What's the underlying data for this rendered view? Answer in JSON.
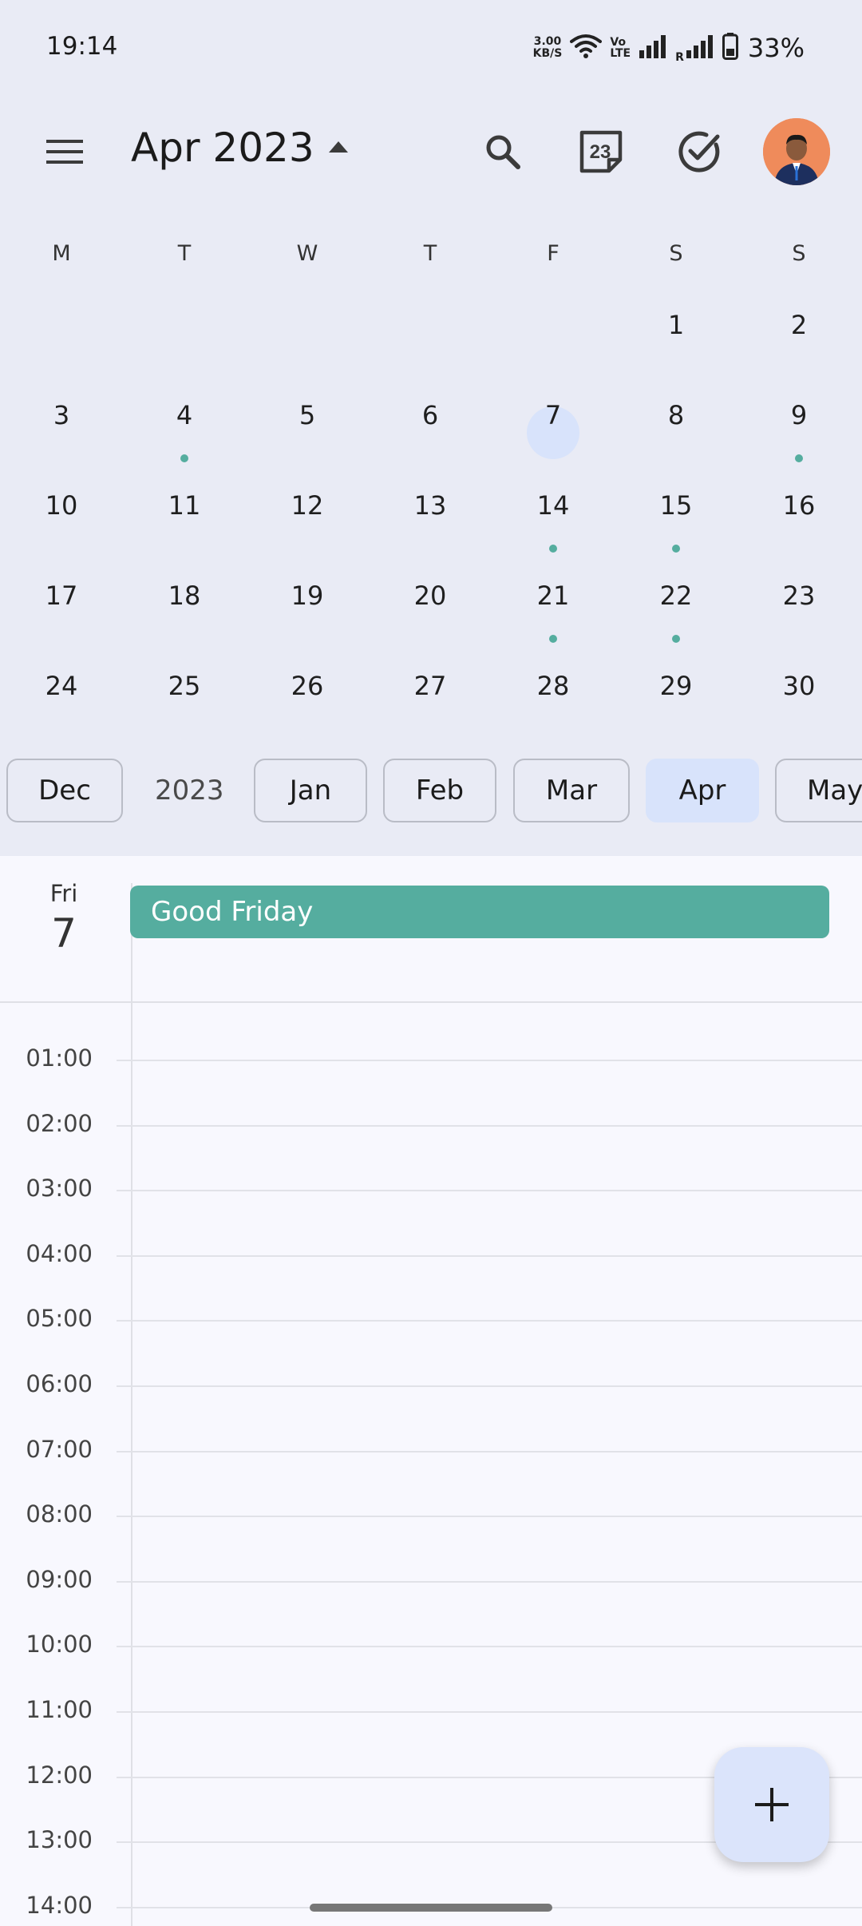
{
  "status_bar": {
    "time": "19:14",
    "net_speed_value": "3.00",
    "net_speed_unit": "KB/S",
    "volte_top": "Vo",
    "volte_bottom": "LTE",
    "roaming_label": "R",
    "battery": "33%"
  },
  "header": {
    "month_title": "Apr 2023",
    "today_date": "23",
    "icons": [
      "menu-icon",
      "caret-up-icon",
      "search-icon",
      "calendar-today-icon",
      "tasks-check-icon",
      "avatar"
    ]
  },
  "weekdays": [
    "M",
    "T",
    "W",
    "T",
    "F",
    "S",
    "S"
  ],
  "month_grid": {
    "weeks": [
      [
        {
          "d": ""
        },
        {
          "d": ""
        },
        {
          "d": ""
        },
        {
          "d": ""
        },
        {
          "d": ""
        },
        {
          "d": "1"
        },
        {
          "d": "2"
        }
      ],
      [
        {
          "d": "3"
        },
        {
          "d": "4",
          "dot": true
        },
        {
          "d": "5"
        },
        {
          "d": "6"
        },
        {
          "d": "7",
          "selected": true
        },
        {
          "d": "8"
        },
        {
          "d": "9",
          "dot": true
        }
      ],
      [
        {
          "d": "10"
        },
        {
          "d": "11"
        },
        {
          "d": "12"
        },
        {
          "d": "13"
        },
        {
          "d": "14",
          "dot": true
        },
        {
          "d": "15",
          "dot": true
        },
        {
          "d": "16"
        }
      ],
      [
        {
          "d": "17"
        },
        {
          "d": "18"
        },
        {
          "d": "19"
        },
        {
          "d": "20"
        },
        {
          "d": "21",
          "dot": true
        },
        {
          "d": "22",
          "dot": true
        },
        {
          "d": "23"
        }
      ],
      [
        {
          "d": "24"
        },
        {
          "d": "25"
        },
        {
          "d": "26"
        },
        {
          "d": "27"
        },
        {
          "d": "28"
        },
        {
          "d": "29"
        },
        {
          "d": "30"
        }
      ]
    ],
    "dot_color": "#55ad9f",
    "selected_color": "#d8e3fb"
  },
  "month_chips": {
    "prev": "Dec",
    "year": "2023",
    "months": [
      "Jan",
      "Feb",
      "Mar",
      "Apr",
      "May"
    ],
    "active": "Apr"
  },
  "day_view": {
    "dow": "Fri",
    "date": "7",
    "event": {
      "title": "Good Friday",
      "color": "#55ad9f"
    },
    "hours": [
      "01:00",
      "02:00",
      "03:00",
      "04:00",
      "05:00",
      "06:00",
      "07:00",
      "08:00",
      "09:00",
      "10:00",
      "11:00",
      "12:00",
      "13:00",
      "14:00"
    ]
  },
  "fab": {
    "icon": "plus-icon"
  }
}
